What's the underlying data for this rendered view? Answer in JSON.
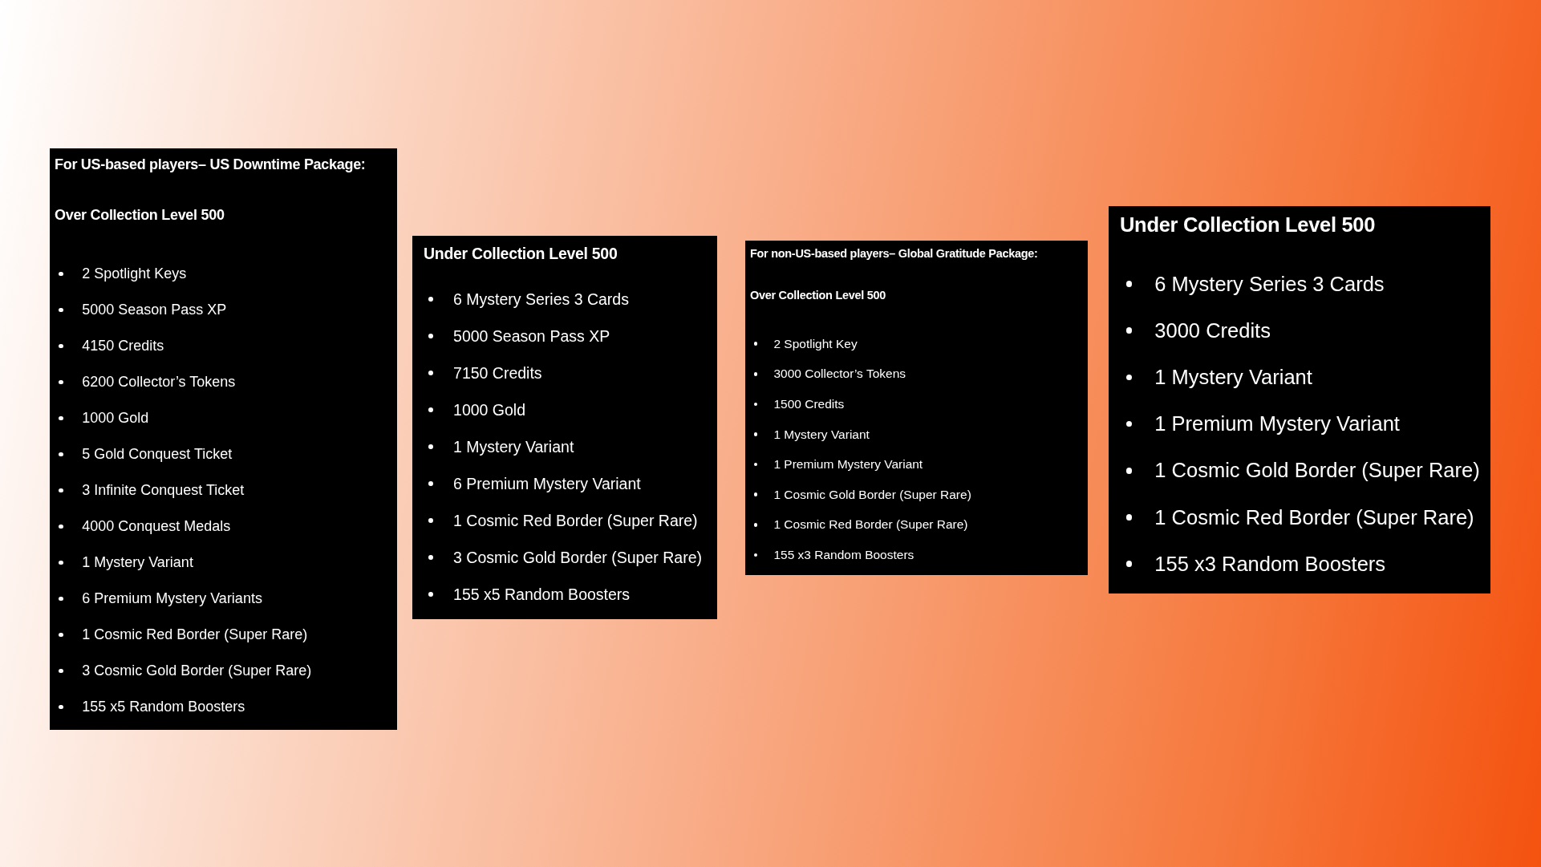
{
  "panels": [
    {
      "headings": [
        "For US-based players– US Downtime Package:",
        "Over Collection Level 500"
      ],
      "items": [
        "2 Spotlight Keys",
        "5000 Season Pass XP",
        "4150 Credits",
        "6200 Collector’s Tokens",
        "1000 Gold",
        "5 Gold Conquest Ticket",
        "3 Infinite Conquest Ticket",
        "4000 Conquest Medals",
        "1 Mystery Variant",
        "6 Premium Mystery Variants",
        "1 Cosmic Red Border (Super Rare)",
        "3 Cosmic Gold Border (Super Rare)",
        "155 x5 Random Boosters"
      ]
    },
    {
      "headings": [
        "Under Collection Level 500"
      ],
      "items": [
        "6 Mystery Series 3 Cards",
        "5000 Season Pass XP",
        "7150 Credits",
        "1000 Gold",
        "1 Mystery Variant",
        "6 Premium Mystery Variant",
        "1 Cosmic Red Border (Super Rare)",
        "3 Cosmic Gold Border (Super Rare)",
        "155 x5 Random Boosters"
      ]
    },
    {
      "headings": [
        "For non-US-based players– Global Gratitude Package:",
        "Over Collection Level 500"
      ],
      "items": [
        "2 Spotlight Key",
        "3000 Collector’s Tokens",
        "1500 Credits",
        "1 Mystery Variant",
        "1 Premium Mystery Variant",
        "1 Cosmic Gold Border (Super Rare)",
        "1 Cosmic Red Border (Super Rare)",
        "155 x3 Random Boosters"
      ]
    },
    {
      "headings": [
        "Under Collection Level 500"
      ],
      "items": [
        "6 Mystery Series 3 Cards",
        "3000 Credits",
        "1 Mystery Variant",
        "1 Premium Mystery Variant",
        "1 Cosmic Gold Border (Super Rare)",
        "1 Cosmic Red Border (Super Rare)",
        "155 x3 Random Boosters"
      ]
    }
  ]
}
